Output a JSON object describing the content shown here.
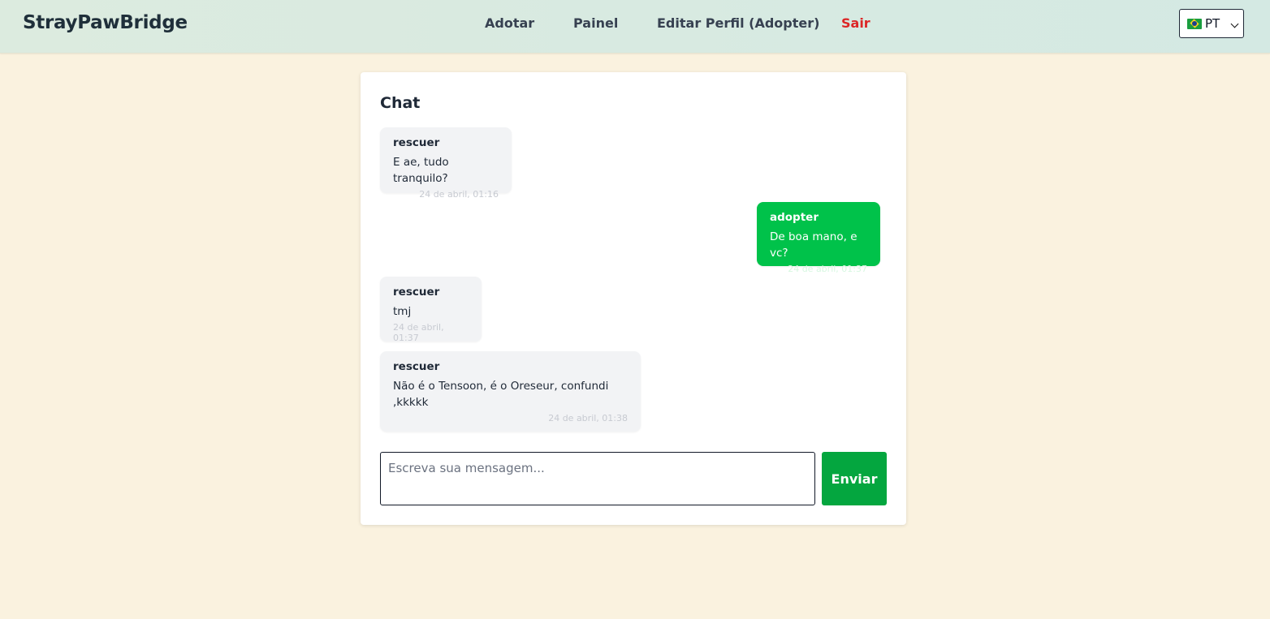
{
  "nav": {
    "brand": "StrayPawBridge",
    "links": {
      "adotar": "Adotar",
      "painel": "Painel",
      "editar": "Editar Perfil (Adopter)",
      "sair": "Sair"
    },
    "language": {
      "selected": "PT",
      "flag_icon": "brazil-flag-icon"
    },
    "sair_color": "#dc2626"
  },
  "chat": {
    "title": "Chat",
    "messages": [
      {
        "author": "rescuer",
        "text": "E ae, tudo tranquilo?",
        "time": "24 de abril, 01:16",
        "direction": "in"
      },
      {
        "author": "adopter",
        "text": "De boa mano, e vc?",
        "time": "24 de abril, 01:37",
        "direction": "out"
      },
      {
        "author": "rescuer",
        "text": "tmj",
        "time": "24 de abril, 01:37",
        "direction": "in"
      },
      {
        "author": "rescuer",
        "text": "Não é o Tensoon, é o Oreseur, confundi ,kkkkk",
        "time": "24 de abril, 01:38",
        "direction": "in"
      }
    ],
    "input": {
      "placeholder": "Escreva sua mensagem...",
      "value": ""
    },
    "send_label": "Enviar",
    "colors": {
      "outgoing": "#00c24a",
      "incoming": "#f2f3f5",
      "send_button": "#04a63f"
    }
  }
}
